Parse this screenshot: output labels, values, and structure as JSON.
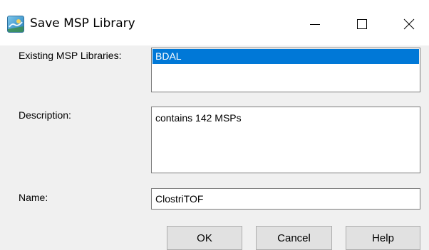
{
  "window": {
    "title": "Save MSP Library"
  },
  "labels": {
    "existing": "Existing MSP Libraries:",
    "description": "Description:",
    "name": "Name:"
  },
  "libraries": {
    "items": [
      "BDAL"
    ],
    "selected": "BDAL"
  },
  "description": {
    "value": "contains 142 MSPs"
  },
  "name": {
    "value": "ClostriTOF"
  },
  "buttons": {
    "ok": "OK",
    "cancel": "Cancel",
    "help": "Help"
  },
  "colors": {
    "selection": "#0078d7",
    "dialog_bg": "#f0f0f0",
    "button_bg": "#e1e1e1"
  }
}
